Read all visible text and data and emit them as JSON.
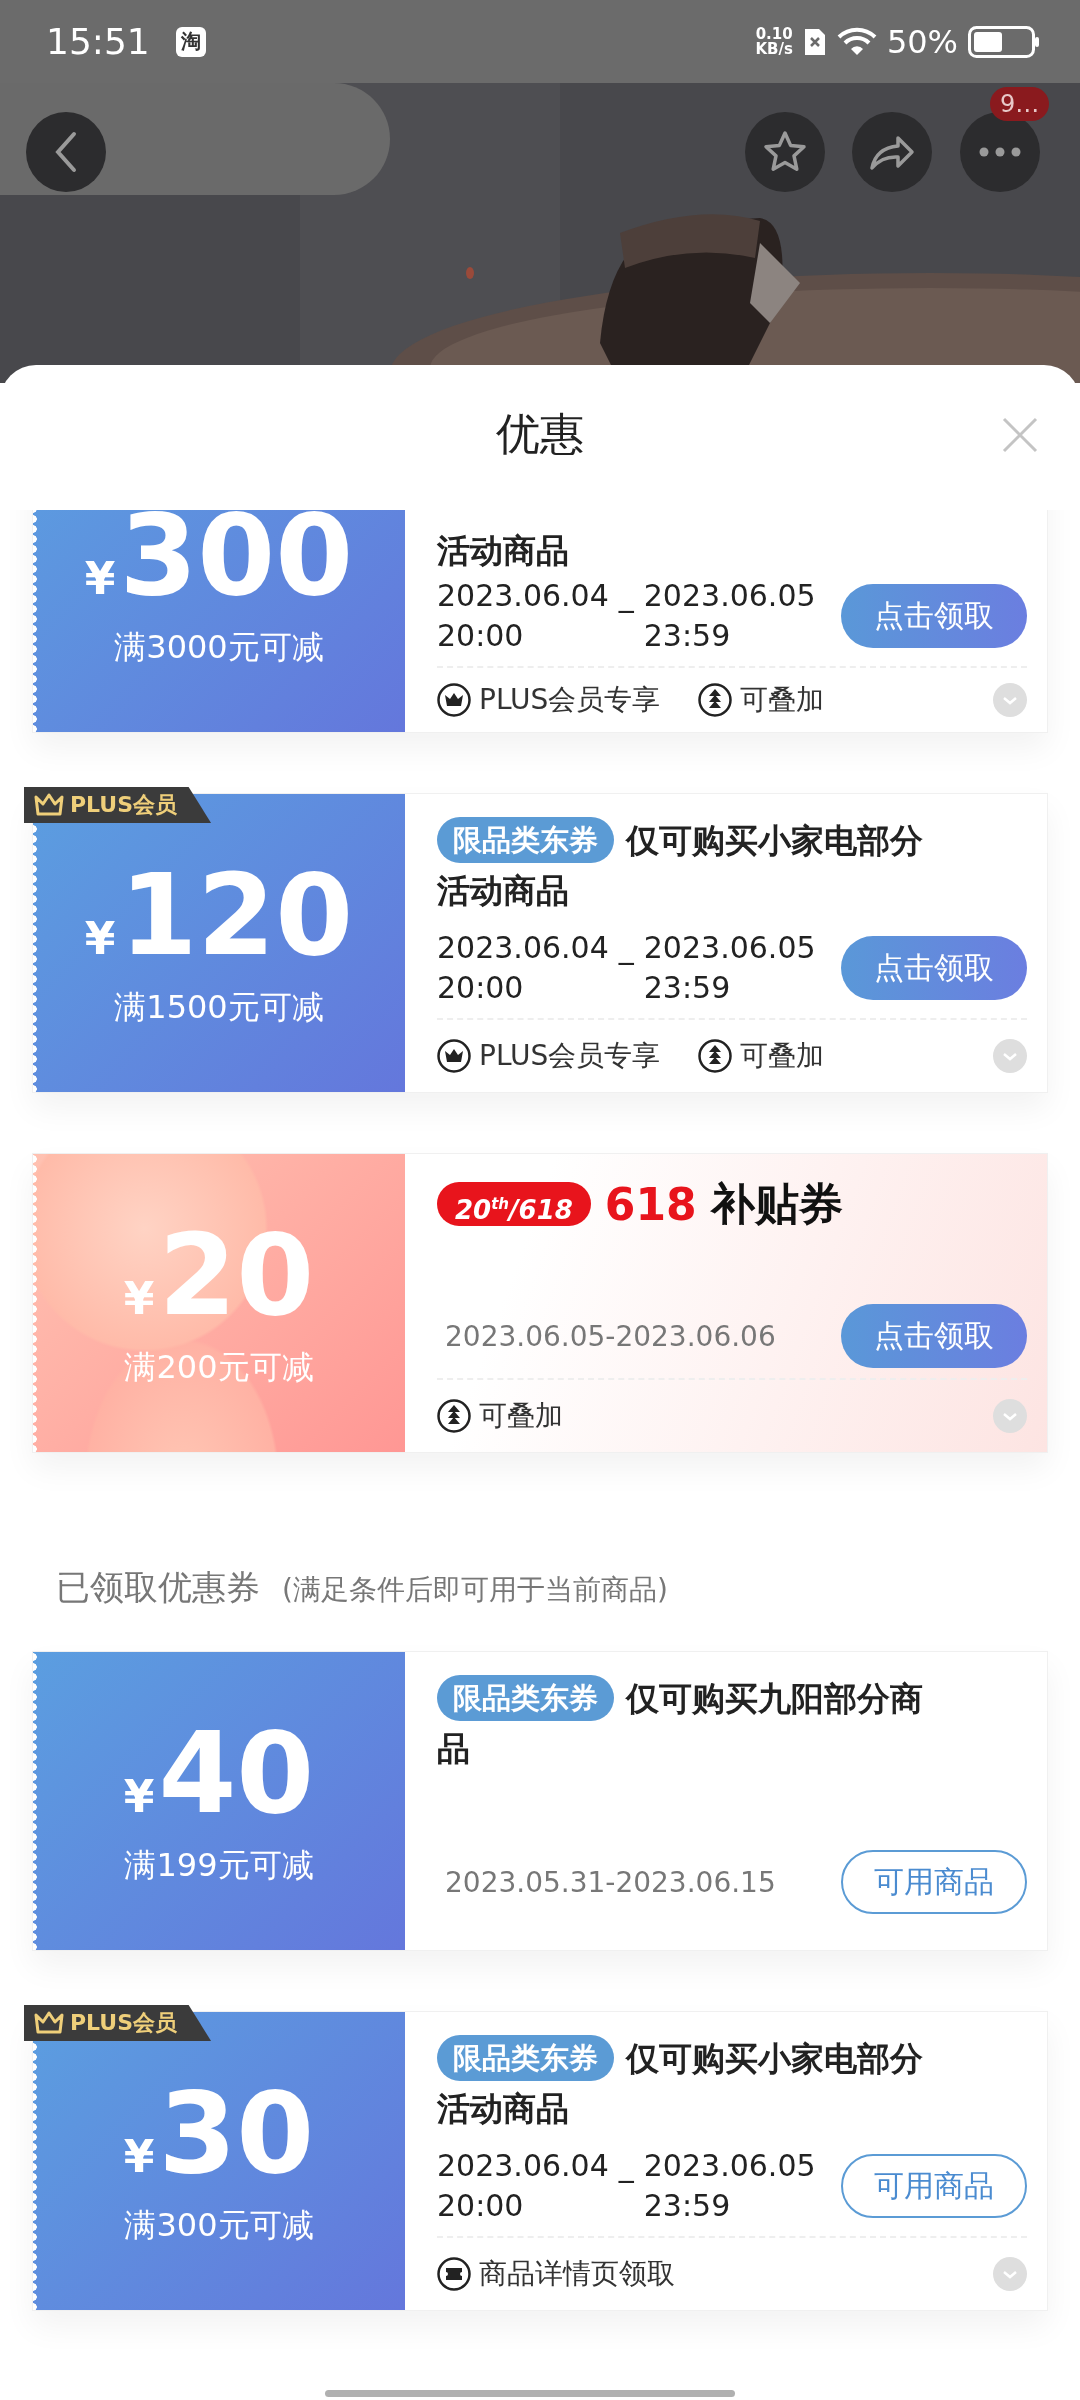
{
  "status_bar": {
    "time": "15:51",
    "app_icon": "淘",
    "net_speed": "0.10",
    "net_unit": "KB/s",
    "battery": "50%"
  },
  "header": {
    "more_badge": "9…"
  },
  "sheet": {
    "title": "优惠",
    "coupons": [
      {
        "kind": "blue",
        "currency": "¥",
        "amount": "300",
        "condition": "满3000元可减",
        "title_lines": [
          "活动商品"
        ],
        "start_date": "2023.06.04",
        "separator": "_",
        "end_date": "2023.06.05",
        "start_time": "20:00",
        "end_time": "23:59",
        "button": {
          "label": "点击领取",
          "kind": "filled"
        },
        "features": [
          {
            "kind": "crown",
            "label": "PLUS会员专享"
          },
          {
            "kind": "stack",
            "label": "可叠加"
          }
        ]
      },
      {
        "kind": "blue",
        "member_badge": "PLUS会员",
        "currency": "¥",
        "amount": "120",
        "condition": "满1500元可减",
        "tag": "限品类东券",
        "title_lines": [
          "仅可购买小家电部分",
          "活动商品"
        ],
        "start_date": "2023.06.04",
        "separator": "_",
        "end_date": "2023.06.05",
        "start_time": "20:00",
        "end_time": "23:59",
        "button": {
          "label": "点击领取",
          "kind": "filled"
        },
        "features": [
          {
            "kind": "crown",
            "label": "PLUS会员专享"
          },
          {
            "kind": "stack",
            "label": "可叠加"
          }
        ]
      },
      {
        "kind": "pink",
        "currency": "¥",
        "amount": "20",
        "condition": "满200元可减",
        "event_badge": "20$^{th}$/618",
        "title_number": "618",
        "title": "补贴券",
        "date_range": "2023.06.05-2023.06.06",
        "button": {
          "label": "点击领取",
          "kind": "filled"
        },
        "features": [
          {
            "kind": "stack",
            "label": "可叠加"
          }
        ]
      }
    ],
    "claimed_section": {
      "title": "已领取优惠券",
      "note": "(满足条件后即可用于当前商品)",
      "coupons": [
        {
          "kind": "blue",
          "currency": "¥",
          "amount": "40",
          "condition": "满199元可减",
          "tag": "限品类东券",
          "title_lines": [
            "仅可购买九阳部分商",
            "品"
          ],
          "date_range": "2023.05.31-2023.06.15",
          "button": {
            "label": "可用商品",
            "kind": "outline"
          }
        },
        {
          "kind": "blue",
          "member_badge": "PLUS会员",
          "currency": "¥",
          "amount": "30",
          "condition": "满300元可减",
          "tag": "限品类东券",
          "title_lines": [
            "仅可购买小家电部分",
            "活动商品"
          ],
          "start_date": "2023.06.04",
          "separator": "_",
          "end_date": "2023.06.05",
          "start_time": "20:00",
          "end_time": "23:59",
          "button": {
            "label": "可用商品",
            "kind": "outline"
          },
          "features": [
            {
              "kind": "ticket",
              "label": "商品详情页领取"
            }
          ]
        }
      ]
    }
  }
}
